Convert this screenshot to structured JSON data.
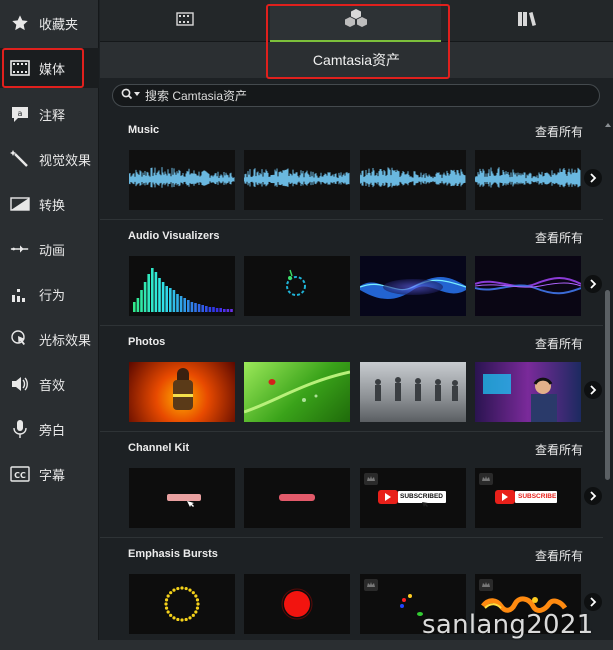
{
  "sidebar": {
    "items": [
      {
        "label": "收藏夹",
        "icon": "star-icon"
      },
      {
        "label": "媒体",
        "icon": "film-icon"
      },
      {
        "label": "注释",
        "icon": "annotation-icon"
      },
      {
        "label": "视觉效果",
        "icon": "magic-wand-icon"
      },
      {
        "label": "转换",
        "icon": "transition-icon"
      },
      {
        "label": "动画",
        "icon": "animation-icon"
      },
      {
        "label": "行为",
        "icon": "behavior-icon"
      },
      {
        "label": "光标效果",
        "icon": "cursor-effect-icon"
      },
      {
        "label": "音效",
        "icon": "speaker-icon"
      },
      {
        "label": "旁白",
        "icon": "microphone-icon"
      },
      {
        "label": "字幕",
        "icon": "closed-caption-icon"
      }
    ],
    "active_index": 1
  },
  "tabs": {
    "items": [
      {
        "icon": "film-icon"
      },
      {
        "icon": "assets-cubes-icon"
      },
      {
        "icon": "library-books-icon"
      }
    ],
    "active_index": 1,
    "active_title": "Camtasia资产"
  },
  "search": {
    "placeholder": "搜索 Camtasia资产"
  },
  "sections": [
    {
      "title": "Music",
      "see_all": "查看所有"
    },
    {
      "title": "Audio Visualizers",
      "see_all": "查看所有"
    },
    {
      "title": "Photos",
      "see_all": "查看所有"
    },
    {
      "title": "Channel Kit",
      "see_all": "查看所有"
    },
    {
      "title": "Emphasis Bursts",
      "see_all": "查看所有"
    }
  ],
  "channel_kit": {
    "subscribe_label_1": "SUBSCRIBED",
    "subscribe_label_2": "SUBSCRIBE"
  },
  "watermark": "sanlang2021",
  "colors": {
    "accent_green": "#7cc03b",
    "highlight_red": "#e0201d",
    "waveform_blue": "#6ab8e0"
  }
}
